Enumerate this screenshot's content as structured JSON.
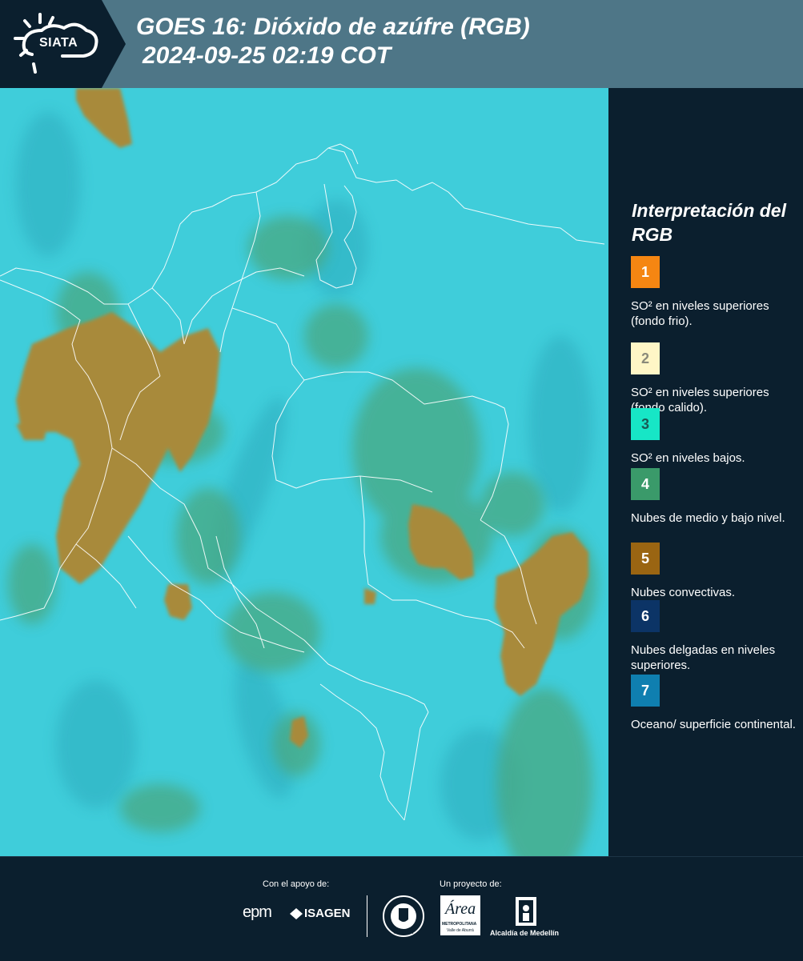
{
  "header": {
    "logo_text": "SIATA",
    "title_line1": "GOES 16: Dióxido de azúfre (RGB)",
    "title_line2": "2024-09-25 02:19 COT"
  },
  "map": {
    "background_color": "#3fcdda",
    "boundary_color": "#ffffff",
    "convective_color": "#a88a3a",
    "midlevel_color": "#4aa882"
  },
  "legend": {
    "title": "Interpretación del RGB",
    "items": [
      {
        "number": "1",
        "label": "SO² en niveles superiores (fondo frio).",
        "color": "#f58612",
        "num_color": "#ffffff"
      },
      {
        "number": "2",
        "label": "SO² en niveles superiores (fondo calido).",
        "color": "#fff6c6",
        "num_color": "#8a8a7a"
      },
      {
        "number": "3",
        "label": "SO² en niveles bajos.",
        "color": "#17e6c6",
        "num_color": "#1a5a55"
      },
      {
        "number": "4",
        "label": "Nubes de medio y bajo nivel.",
        "color": "#3a9a6a",
        "num_color": "#ffffff"
      },
      {
        "number": "5",
        "label": "Nubes convectivas.",
        "color": "#9a6512",
        "num_color": "#ffffff"
      },
      {
        "number": "6",
        "label": "Nubes delgadas en niveles superiores.",
        "color": "#0c3466",
        "num_color": "#ffffff"
      },
      {
        "number": "7",
        "label": "Oceano/ superficie continental.",
        "color": "#0f7fb0",
        "num_color": "#ffffff"
      }
    ]
  },
  "footer": {
    "support_label": "Con el apoyo de:",
    "project_label": "Un proyecto de:",
    "sponsor_epm": "epm",
    "sponsor_isagen": "ISAGEN",
    "logo_medellin_seal": "MEDELLÍN",
    "logo_area_name": "Área",
    "logo_area_sub1": "METROPOLITANA",
    "logo_area_sub2": "Valle de Aburrá",
    "logo_alcaldia": "Alcaldía de Medellín"
  }
}
